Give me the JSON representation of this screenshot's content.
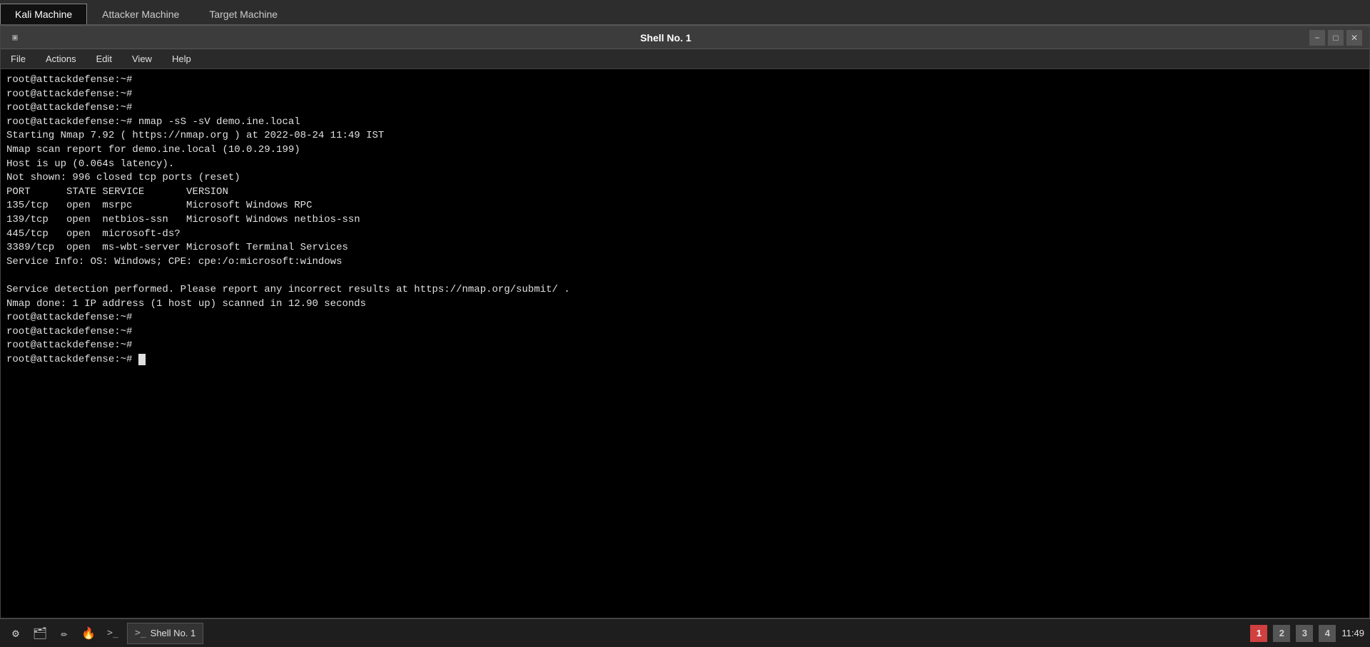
{
  "tabs": [
    {
      "id": "kali",
      "label": "Kali Machine",
      "active": true
    },
    {
      "id": "attacker",
      "label": "Attacker Machine",
      "active": false
    },
    {
      "id": "target",
      "label": "Target Machine",
      "active": false
    }
  ],
  "titlebar": {
    "icon": "▣",
    "title": "Shell No. 1",
    "minimize": "−",
    "maximize": "□",
    "close": "✕"
  },
  "menubar": {
    "items": [
      "File",
      "Actions",
      "Edit",
      "View",
      "Help"
    ]
  },
  "terminal": {
    "lines": [
      "root@attackdefense:~#",
      "root@attackdefense:~#",
      "root@attackdefense:~#",
      "root@attackdefense:~# nmap -sS -sV demo.ine.local",
      "Starting Nmap 7.92 ( https://nmap.org ) at 2022-08-24 11:49 IST",
      "Nmap scan report for demo.ine.local (10.0.29.199)",
      "Host is up (0.064s latency).",
      "Not shown: 996 closed tcp ports (reset)",
      "PORT      STATE SERVICE       VERSION",
      "135/tcp   open  msrpc         Microsoft Windows RPC",
      "139/tcp   open  netbios-ssn   Microsoft Windows netbios-ssn",
      "445/tcp   open  microsoft-ds?",
      "3389/tcp  open  ms-wbt-server Microsoft Terminal Services",
      "Service Info: OS: Windows; CPE: cpe:/o:microsoft:windows",
      "",
      "Service detection performed. Please report any incorrect results at https://nmap.org/submit/ .",
      "Nmap done: 1 IP address (1 host up) scanned in 12.90 seconds",
      "root@attackdefense:~#",
      "root@attackdefense:~#",
      "root@attackdefense:~#",
      "root@attackdefense:~# "
    ],
    "prompt_suffix": "#"
  },
  "taskbar": {
    "icons": [
      {
        "id": "settings",
        "symbol": "⚙"
      },
      {
        "id": "files",
        "symbol": "🗂"
      },
      {
        "id": "text-editor",
        "symbol": "✏"
      },
      {
        "id": "firefox",
        "symbol": "🦊"
      },
      {
        "id": "terminal-icon",
        "symbol": ">_"
      }
    ],
    "app_label": "Shell No. 1",
    "pager": [
      "1",
      "2",
      "3",
      "4"
    ],
    "active_page": "1",
    "time": "11:49"
  }
}
